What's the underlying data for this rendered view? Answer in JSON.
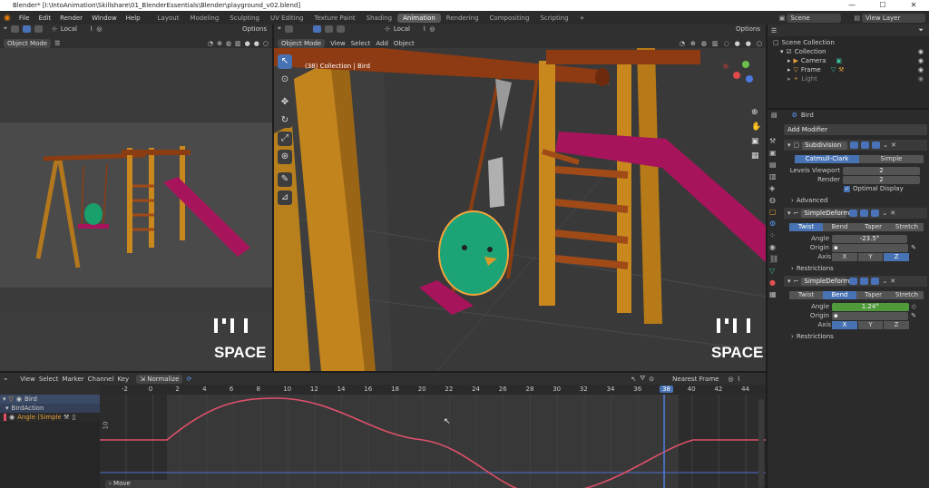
{
  "window": {
    "title": "Blender* [I:\\IntoAnimation\\Skillshare\\01_BlenderEssentials\\Blender\\playground_v02.blend]",
    "minimize": "—",
    "maximize": "☐",
    "close": "✕"
  },
  "menubar": {
    "menus": [
      "File",
      "Edit",
      "Render",
      "Window",
      "Help"
    ],
    "workspaces": [
      "Layout",
      "Modeling",
      "Sculpting",
      "UV Editing",
      "Texture Paint",
      "Shading",
      "Animation",
      "Rendering",
      "Compositing",
      "Scripting"
    ],
    "active_workspace": "Animation",
    "add": "+",
    "scene": "Scene",
    "view_layer": "View Layer"
  },
  "left_viewport": {
    "mode": "Object Mode",
    "orientation": "Local",
    "options": "Options",
    "watermark": "SPACE"
  },
  "main_viewport": {
    "mode": "Object Mode",
    "menus": [
      "View",
      "Select",
      "Add",
      "Object"
    ],
    "orientation": "Local",
    "options": "Options",
    "info": "(38) Collection | Bird",
    "watermark": "SPACE"
  },
  "outliner": {
    "root": "Scene Collection",
    "items": [
      {
        "label": "Collection"
      },
      {
        "label": "Camera"
      },
      {
        "label": "Frame"
      },
      {
        "label": "Light"
      }
    ]
  },
  "properties": {
    "object_name": "Bird",
    "add_modifier": "Add Modifier",
    "subdivision": {
      "name": "Subdivision",
      "tabs": [
        "Catmull-Clark",
        "Simple"
      ],
      "active_tab": "Catmull-Clark",
      "levels_label": "Levels Viewport",
      "levels_value": "2",
      "render_label": "Render",
      "render_value": "2",
      "optimal_label": "Optimal Display",
      "advanced": "Advanced"
    },
    "deform1": {
      "name": "SimpleDeform",
      "tabs": [
        "Twist",
        "Bend",
        "Taper",
        "Stretch"
      ],
      "active_tab": "Twist",
      "angle_label": "Angle",
      "angle_value": "-23.5°",
      "origin_label": "Origin",
      "axis_label": "Axis",
      "axes": [
        "X",
        "Y",
        "Z"
      ],
      "active_axis": "Z",
      "restrictions": "Restrictions"
    },
    "deform2": {
      "name": "SimpleDeform...",
      "tabs": [
        "Twist",
        "Bend",
        "Taper",
        "Stretch"
      ],
      "active_tab": "Bend",
      "angle_label": "Angle",
      "angle_value": "1.24°",
      "origin_label": "Origin",
      "axis_label": "Axis",
      "axes": [
        "X",
        "Y",
        "Z"
      ],
      "active_axis": "X",
      "restrictions": "Restrictions"
    }
  },
  "graph_editor": {
    "menus": [
      "View",
      "Select",
      "Marker",
      "Channel",
      "Key"
    ],
    "normalize": "Normalize",
    "snap": "Nearest Frame",
    "channels": [
      {
        "label": "Bird"
      },
      {
        "label": "BirdAction"
      },
      {
        "label": "Angle (SimpleDeform)"
      }
    ],
    "frame_ticks": [
      "-2",
      "0",
      "2",
      "4",
      "6",
      "8",
      "10",
      "12",
      "14",
      "16",
      "18",
      "20",
      "22",
      "24",
      "26",
      "28",
      "30",
      "32",
      "34",
      "36",
      "38",
      "40",
      "42",
      "44"
    ],
    "current_frame": "38",
    "y_tick": "10",
    "status": "Move",
    "curve_color": "#e0506a"
  }
}
